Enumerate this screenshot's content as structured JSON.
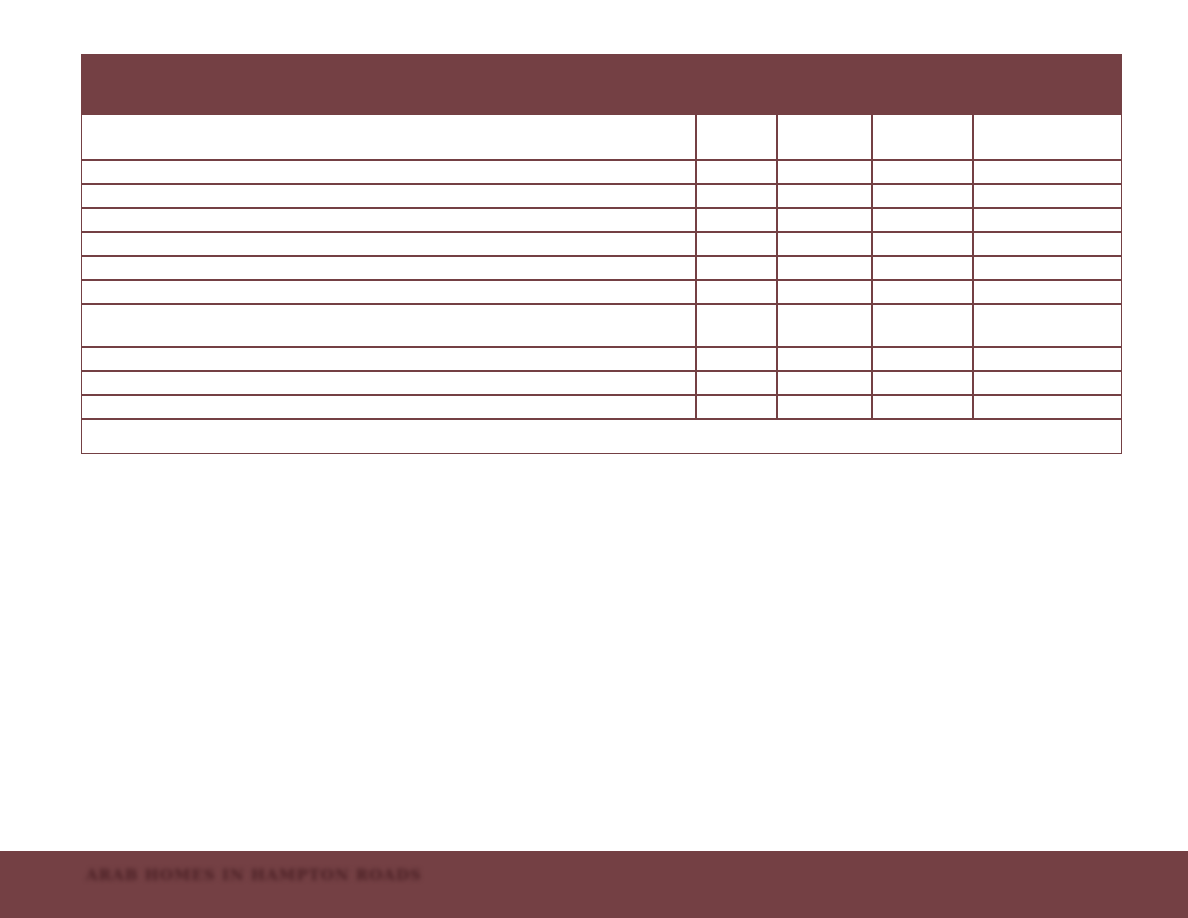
{
  "footer": {
    "text": "ARAB HOMES IN HAMPTON ROADS"
  },
  "colors": {
    "accent": "#744044",
    "background": "#ffffff"
  },
  "table": {
    "columns": 5,
    "body_rows": 10
  }
}
